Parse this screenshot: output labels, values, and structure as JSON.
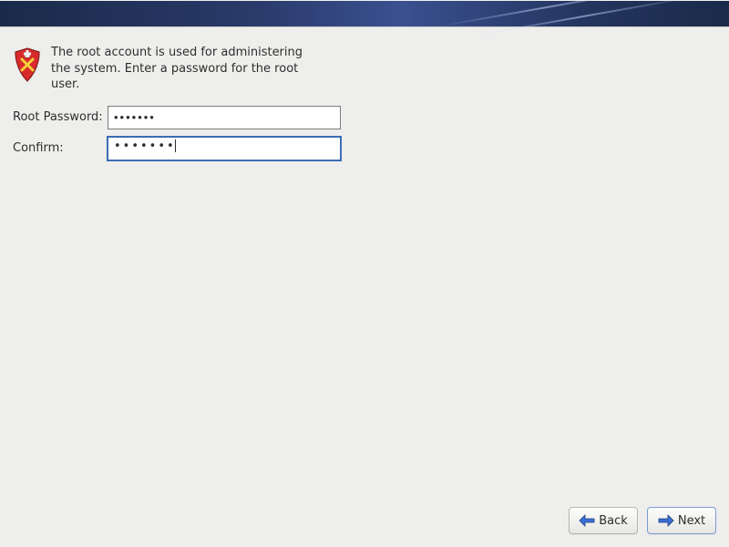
{
  "intro_text": "The root account is used for administering the system.  Enter a password for the root user.",
  "form": {
    "root_password_label": "Root Password:",
    "root_password_value": "•••••••",
    "confirm_label": "Confirm:",
    "confirm_value": "•••••••"
  },
  "buttons": {
    "back_label": "Back",
    "next_label": "Next"
  },
  "icons": {
    "shield": "shield-icon",
    "arrow_left": "arrow-left-icon",
    "arrow_right": "arrow-right-icon"
  }
}
